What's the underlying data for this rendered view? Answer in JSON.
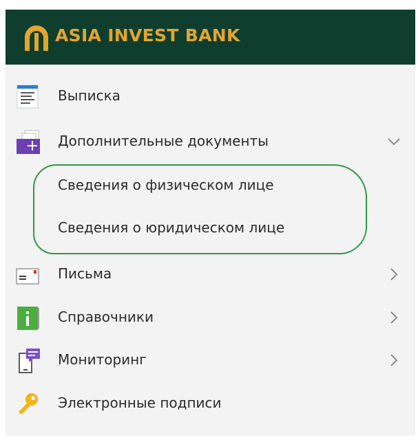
{
  "header": {
    "brand": "ASIA INVEST BANK",
    "colors": {
      "background": "#0f3e2e",
      "brand": "#e2a52f"
    }
  },
  "menu": {
    "items": [
      {
        "label": "Выписка",
        "icon": "statement-icon"
      },
      {
        "label": "Дополнительные документы",
        "icon": "add-document-icon",
        "expanded": true,
        "children": [
          {
            "label": "Сведения о физическом лице"
          },
          {
            "label": "Сведения о юридическом лице"
          }
        ]
      },
      {
        "label": "Письма",
        "icon": "letter-icon"
      },
      {
        "label": "Справочники",
        "icon": "info-book-icon"
      },
      {
        "label": "Мониторинг",
        "icon": "monitoring-icon"
      },
      {
        "label": "Электронные подписи",
        "icon": "key-icon"
      }
    ]
  },
  "annotation": {
    "outline_color": "#2f9a44"
  }
}
